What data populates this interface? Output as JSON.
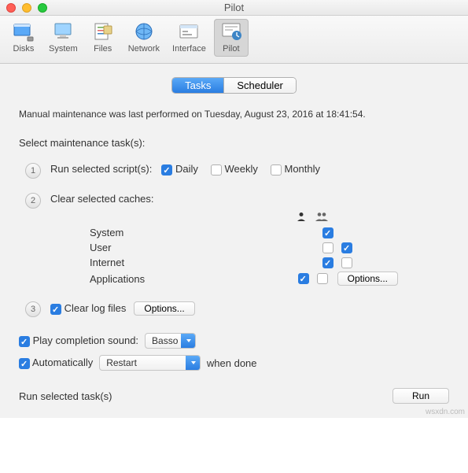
{
  "window": {
    "title": "Pilot"
  },
  "toolbar": {
    "items": [
      {
        "label": "Disks"
      },
      {
        "label": "System"
      },
      {
        "label": "Files"
      },
      {
        "label": "Network"
      },
      {
        "label": "Interface"
      },
      {
        "label": "Pilot"
      }
    ]
  },
  "tabs": {
    "tasks": "Tasks",
    "scheduler": "Scheduler"
  },
  "status_text": "Manual maintenance was last performed on Tuesday, August 23, 2016 at 18:41:54.",
  "section_title": "Select maintenance task(s):",
  "step1": {
    "label": "Run selected script(s):",
    "daily": "Daily",
    "weekly": "Weekly",
    "monthly": "Monthly"
  },
  "step2": {
    "label": "Clear selected caches:",
    "rows": {
      "system": "System",
      "user": "User",
      "internet": "Internet",
      "applications": "Applications"
    },
    "options_btn": "Options..."
  },
  "step3": {
    "label": "Clear log files",
    "options_btn": "Options..."
  },
  "completion": {
    "label": "Play completion sound:",
    "select": "Basso"
  },
  "auto": {
    "label": "Automatically",
    "select": "Restart",
    "suffix": "when done"
  },
  "run": {
    "label": "Run selected task(s)",
    "button": "Run"
  },
  "watermark": "wsxdn.com"
}
